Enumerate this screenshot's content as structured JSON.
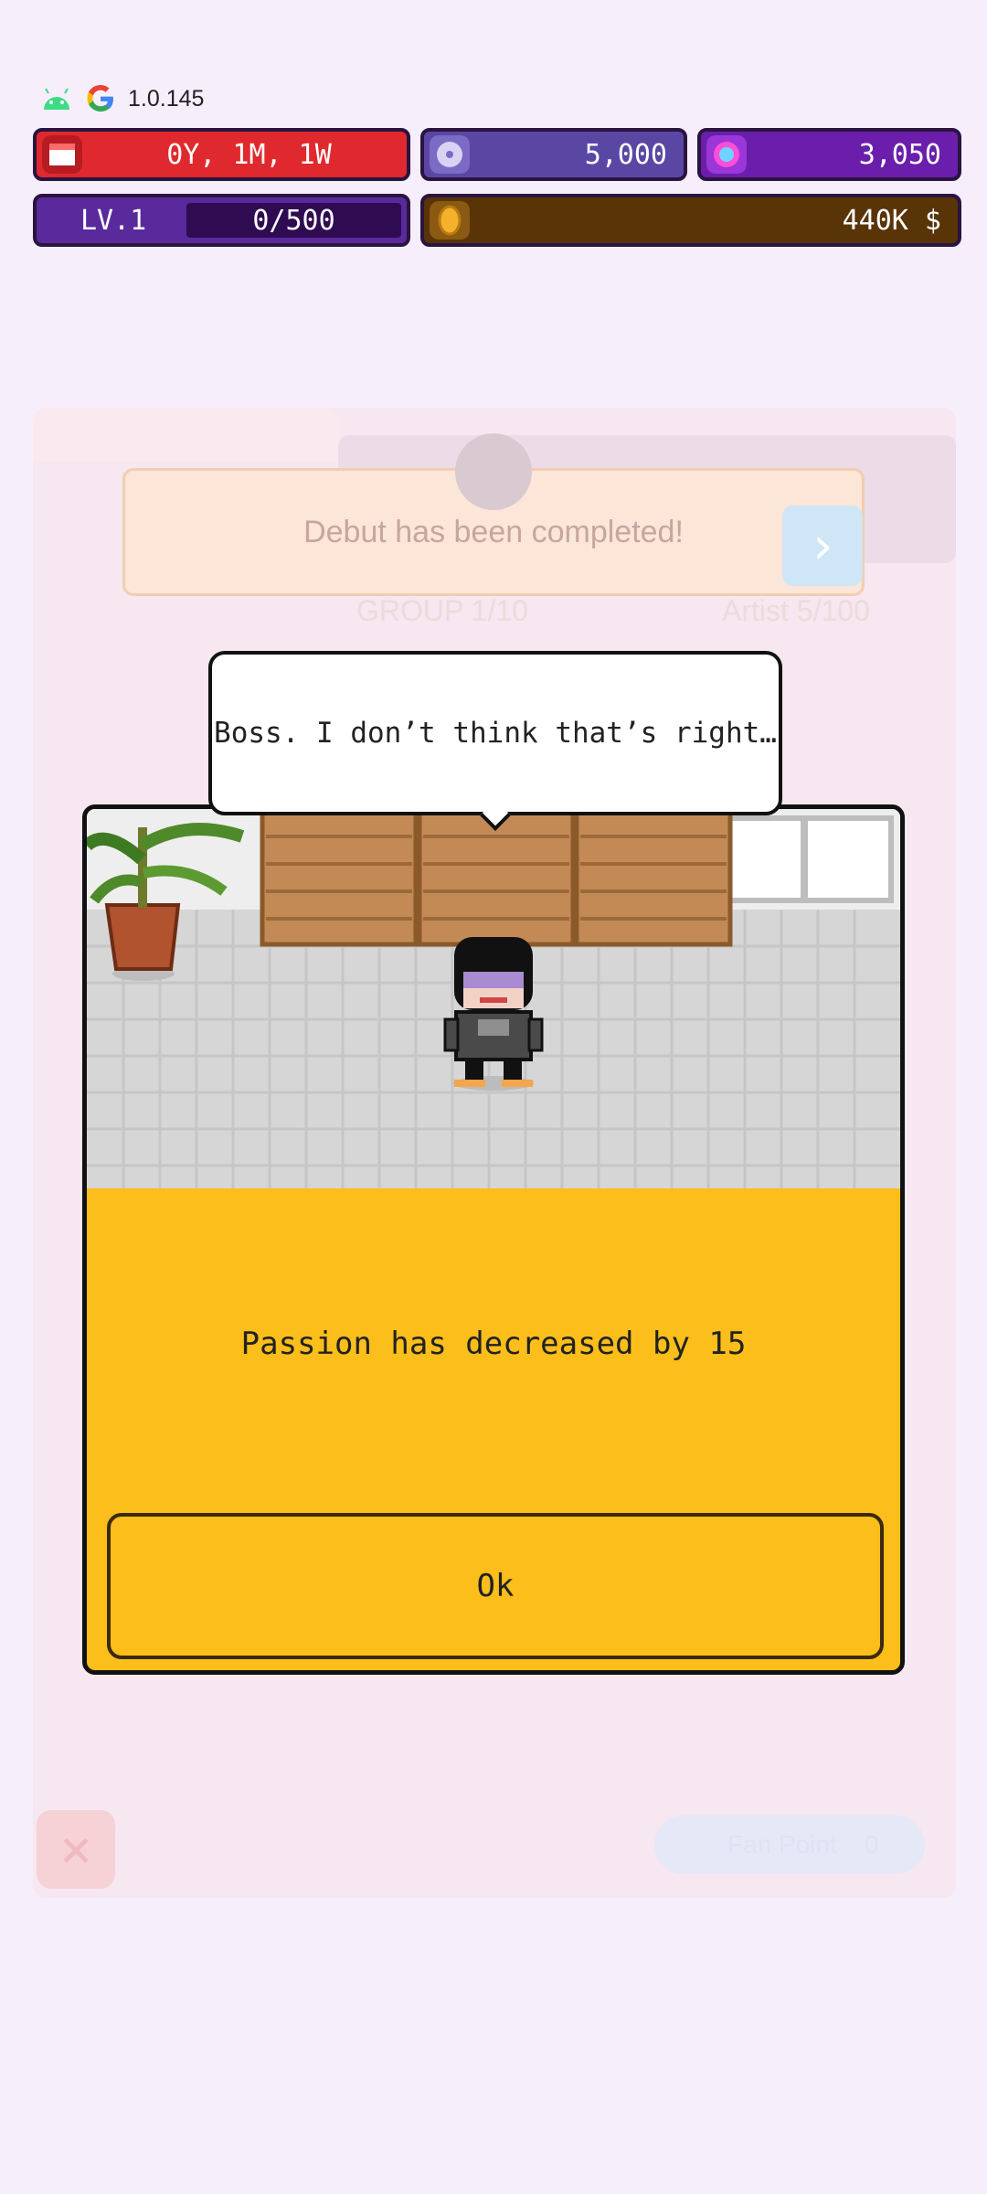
{
  "status_bar": {
    "version": "1.0.145",
    "icons": [
      "android-icon",
      "google-icon"
    ]
  },
  "hud": {
    "time": "0Y, 1M, 1W",
    "discs": "5,000",
    "gems": "3,050",
    "level": "LV.1",
    "xp": "0/500",
    "money": "440K $"
  },
  "background": {
    "notification": "Debut has been completed!",
    "group_label": "GROUP 1/10",
    "artist_label": "Artist 5/100",
    "fan_point_label": "Fan Point",
    "fan_point_value": "0"
  },
  "dialog": {
    "speech": "Boss. I don’t think that’s right…",
    "message": "Passion has decreased by 15",
    "ok_label": "Ok"
  },
  "colors": {
    "background": "#f6effb",
    "time_bar": "#e0292f",
    "disc_bar": "#5a47a3",
    "gem_bar": "#6a1eab",
    "level_bar": "#5a2a9c",
    "money_bar": "#583407",
    "dialog_panel": "#fbbe1a"
  }
}
